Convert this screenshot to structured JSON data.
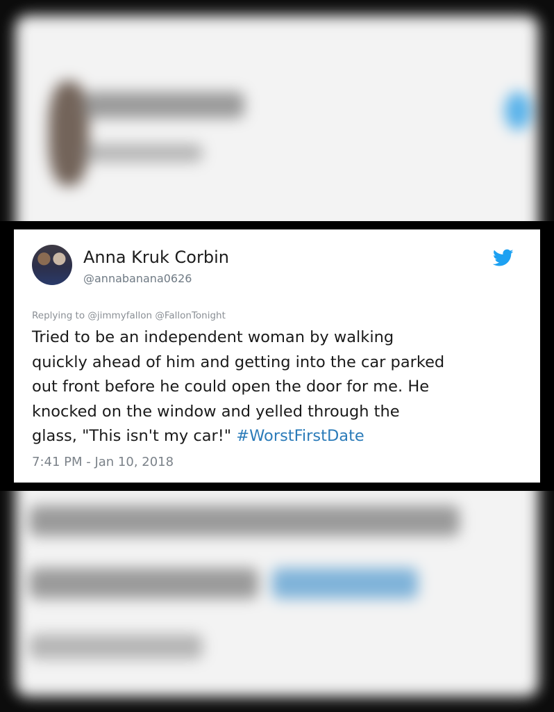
{
  "tweet": {
    "display_name": "Anna Kruk Corbin",
    "handle": "@annabanana0626",
    "replying_label": "Replying to",
    "replying_to": "@jimmyfallon @FallonTonight",
    "body_text": "Tried to be an independent woman by walking\nquickly ahead of him and getting into the car parked\nout front before he could open the door for me. He\nknocked on the window and yelled through the\nglass, \"This isn't my car!\" ",
    "hashtag": "#WorstFirstDate",
    "timestamp": "7:41 PM - Jan 10, 2018"
  },
  "icons": {
    "brand": "twitter-bird-icon",
    "avatar": "profile-photo"
  },
  "colors": {
    "brand_blue": "#1da1f2",
    "link_blue": "#2b7bb9",
    "text": "#1a1a1a",
    "muted": "#7b8289"
  }
}
